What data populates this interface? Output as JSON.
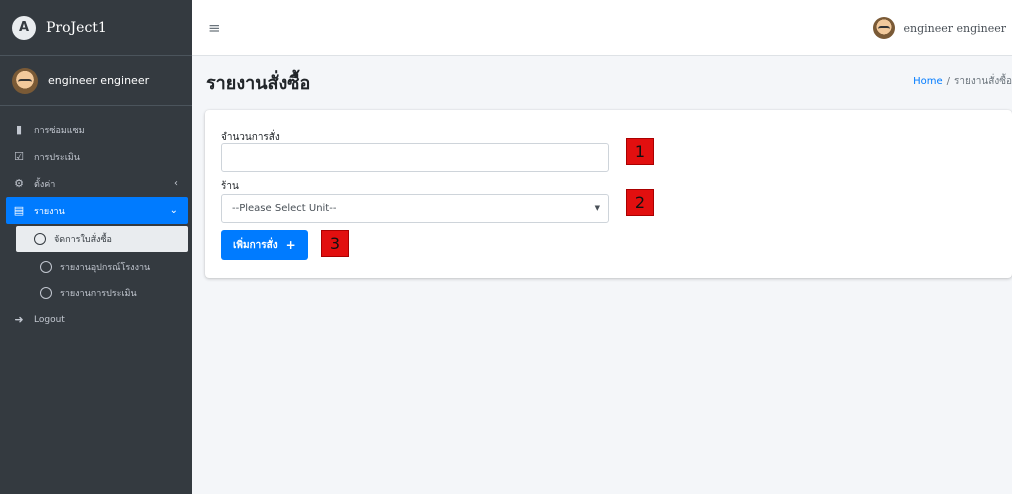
{
  "brand": {
    "logo_letter": "A",
    "name": "ProJect1"
  },
  "user": {
    "name": "engineer engineer"
  },
  "sidebar": {
    "items": [
      {
        "label": "การซ่อมแซม",
        "icon": "clipboard-icon"
      },
      {
        "label": "การประเมิน",
        "icon": "clipboard-check-icon"
      },
      {
        "label": "ตั้งค่า",
        "icon": "gear-icon"
      },
      {
        "label": "รายงาน",
        "icon": "pdf-file-icon"
      }
    ],
    "sub_items": [
      {
        "label": "จัดการใบสั่งซื้อ"
      },
      {
        "label": "รายงานอุปกรณ์โรงงาน"
      },
      {
        "label": "รายงานการประเมิน"
      }
    ],
    "logout": {
      "label": "Logout"
    }
  },
  "topbar": {
    "user_name": "engineer engineer"
  },
  "page": {
    "title": "รายงานสั่งซื้อ",
    "breadcrumb_home": "Home",
    "breadcrumb_sep": "/",
    "breadcrumb_current": "รายงานสั่งซื้อ"
  },
  "form": {
    "qty_label": "จำนวนการสั่ง",
    "qty_value": "",
    "shop_label": "ร้าน",
    "shop_selected": "--Please Select Unit--",
    "submit_label": "เพิ่มการสั่ง",
    "submit_icon": "+"
  },
  "markers": [
    "1",
    "2",
    "3"
  ],
  "colors": {
    "sidebar": "#343a40",
    "accent": "#007bff",
    "marker": "#e20f0f"
  }
}
